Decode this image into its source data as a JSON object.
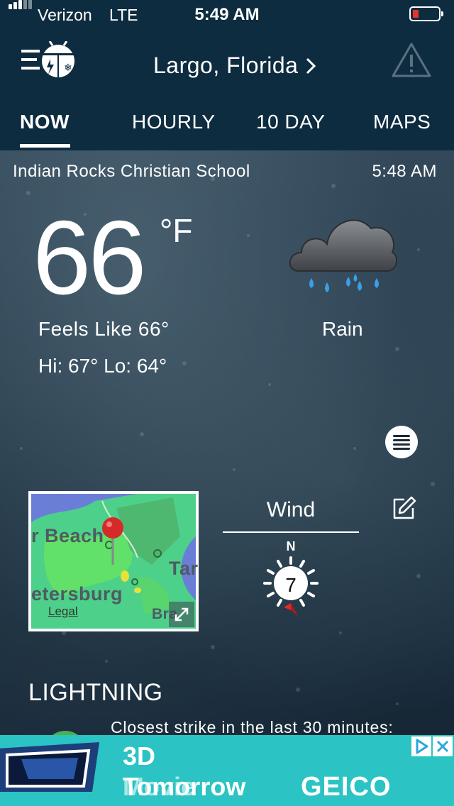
{
  "status": {
    "carrier": "Verizon",
    "network": "LTE",
    "time": "5:49 AM",
    "battery_color": "#e8332a"
  },
  "header": {
    "menu_icon": "hamburger-bug-logo-icon",
    "location": "Largo, Florida",
    "location_chevron": "›",
    "alert_icon": "warning-triangle-icon"
  },
  "tabs": [
    {
      "label": "NOW",
      "active": true
    },
    {
      "label": "HOURLY",
      "active": false
    },
    {
      "label": "10 DAY",
      "active": false
    },
    {
      "label": "MAPS",
      "active": false
    }
  ],
  "current": {
    "station": "Indian Rocks Christian School",
    "observed_time": "5:48 AM",
    "temperature": "66",
    "unit": "°F",
    "feels_like": "Feels Like 66°",
    "hi_lo": "Hi: 67°  Lo: 64°",
    "condition": "Rain",
    "condition_icon": "rain-cloud-icon"
  },
  "map": {
    "labels": [
      "r Beach",
      "etersburg",
      "Tar",
      "Bra"
    ],
    "legal": "Legal"
  },
  "wind": {
    "title": "Wind",
    "compass_n": "N",
    "speed": "7"
  },
  "lightning": {
    "title": "LIGHTNING",
    "text": "Closest strike in the last 30 minutes:"
  },
  "ad": {
    "line1": "3D",
    "line2": "Movie",
    "line3": "Tomorrow",
    "brand": "GEICO",
    "bg_color": "#2bc3c4"
  }
}
